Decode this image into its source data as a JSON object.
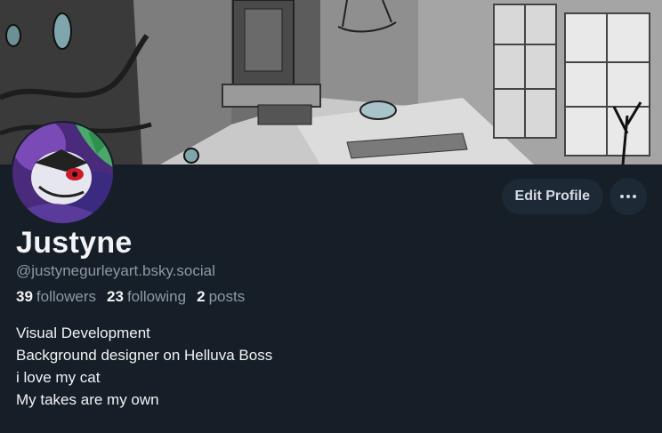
{
  "profile": {
    "display_name": "Justyne",
    "handle": "@justynegurleyart.bsky.social",
    "stats": {
      "followers_count": "39",
      "followers_label": "followers",
      "following_count": "23",
      "following_label": "following",
      "posts_count": "2",
      "posts_label": "posts"
    },
    "bio": [
      "Visual Development",
      "Background designer on Helluva Boss",
      "i love my cat",
      "My takes are my own"
    ]
  },
  "actions": {
    "edit_label": "Edit Profile",
    "more_icon": "ellipsis-icon"
  },
  "colors": {
    "background": "#161e27",
    "button_bg": "#1e2936",
    "muted_text": "#8d99a6",
    "primary_text": "#f1f3f5"
  }
}
